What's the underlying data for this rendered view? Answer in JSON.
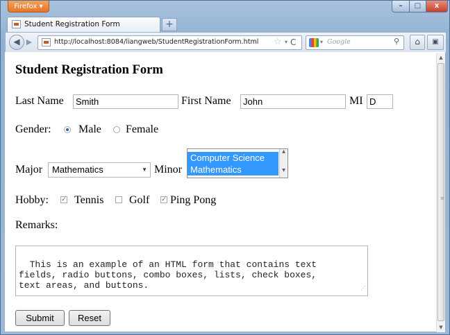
{
  "browser": {
    "app_button_label": "Firefox ▾",
    "window_controls": {
      "minimize": "–",
      "maximize": "□",
      "close": "x"
    },
    "tab": {
      "title": "Student Registration Form"
    },
    "new_tab_label": "+",
    "back_label": "◀",
    "forward_label": "▶",
    "url": "http://localhost:8084/liangweb/StudentRegistrationForm.html",
    "star_label": "☆",
    "dropdown_label": "▾",
    "reload_label": "C",
    "search_placeholder": "Google",
    "search_dropdown_label": "▾",
    "search_icon_label": "⚲",
    "home_label": "⌂",
    "extension_label": "▣"
  },
  "form": {
    "heading": "Student Registration Form",
    "last_name_label": "Last Name",
    "last_name_value": "Smith",
    "first_name_label": "First Name",
    "first_name_value": "John",
    "mi_label": "MI",
    "mi_value": "D",
    "gender_label": "Gender:",
    "gender_options": [
      {
        "label": "Male",
        "selected": true
      },
      {
        "label": "Female",
        "selected": false
      }
    ],
    "major_label": "Major",
    "major_value": "Mathematics",
    "minor_label": "Minor",
    "minor_options": [
      "Computer Science",
      "Mathematics"
    ],
    "hobby_label": "Hobby:",
    "hobbies": [
      {
        "label": "Tennis",
        "checked": true
      },
      {
        "label": "Golf",
        "checked": false
      },
      {
        "label": "Ping Pong",
        "checked": true
      }
    ],
    "remarks_label": "Remarks:",
    "remarks_text": "This is an example of an HTML form that contains text\nfields, radio buttons, combo boxes, lists, check boxes,\ntext areas, and buttons.",
    "submit_label": "Submit",
    "reset_label": "Reset"
  },
  "colors": {
    "selection": "#3399ff",
    "title_bar": "#8fb0d3",
    "firefox_orange": "#e5752a"
  }
}
